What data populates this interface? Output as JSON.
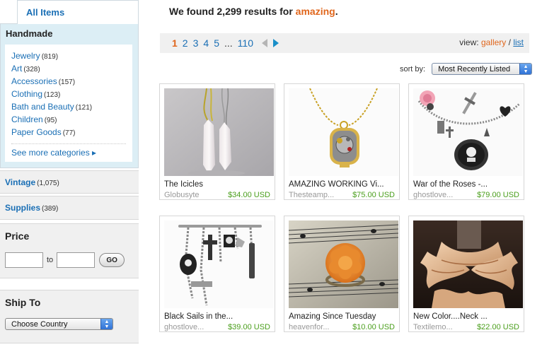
{
  "sidebar": {
    "all_items": "All Items",
    "handmade_title": "Handmade",
    "categories": [
      {
        "label": "Jewelry",
        "count": "(819)"
      },
      {
        "label": "Art",
        "count": "(328)"
      },
      {
        "label": "Accessories",
        "count": "(157)"
      },
      {
        "label": "Clothing",
        "count": "(123)"
      },
      {
        "label": "Bath and Beauty",
        "count": "(121)"
      },
      {
        "label": "Children",
        "count": "(95)"
      },
      {
        "label": "Paper Goods",
        "count": "(77)"
      }
    ],
    "see_more": "See more categories ▸",
    "vintage": {
      "label": "Vintage",
      "count": "(1,075)"
    },
    "supplies": {
      "label": "Supplies",
      "count": "(389)"
    },
    "price": {
      "title": "Price",
      "to_label": "to",
      "go_label": "GO",
      "min_value": "",
      "max_value": ""
    },
    "ship_to": {
      "title": "Ship To",
      "selected": "Choose Country"
    }
  },
  "header": {
    "prefix": "We found 2,299 results for ",
    "term": "amazing",
    "suffix": "."
  },
  "pager": {
    "pages": [
      "1",
      "2",
      "3",
      "4",
      "5"
    ],
    "current": "1",
    "ellipsis": "...",
    "last": "110",
    "view_label": "view:",
    "gallery_label": "gallery",
    "separator": "/",
    "list_label": "list"
  },
  "sort": {
    "label": "sort by:",
    "selected": "Most Recently Listed"
  },
  "listings": [
    {
      "title": "The Icicles",
      "shop": "Globusyte",
      "price": "$34.00 USD"
    },
    {
      "title": "AMAZING WORKING Vi...",
      "shop": "Thesteamp...",
      "price": "$75.00 USD"
    },
    {
      "title": "War of the Roses -...",
      "shop": "ghostlove...",
      "price": "$79.00 USD"
    },
    {
      "title": "Black Sails in the...",
      "shop": "ghostlove...",
      "price": "$39.00 USD"
    },
    {
      "title": "Amazing Since Tuesday",
      "shop": "heavenfor...",
      "price": "$10.00 USD"
    },
    {
      "title": "New Color....Neck ...",
      "shop": "Textilemo...",
      "price": "$22.00 USD"
    }
  ],
  "colors": {
    "link": "#1a6fb5",
    "accent_orange": "#e0661c",
    "price_green": "#4a9e1c",
    "sidebar_blue": "#dceef5"
  }
}
